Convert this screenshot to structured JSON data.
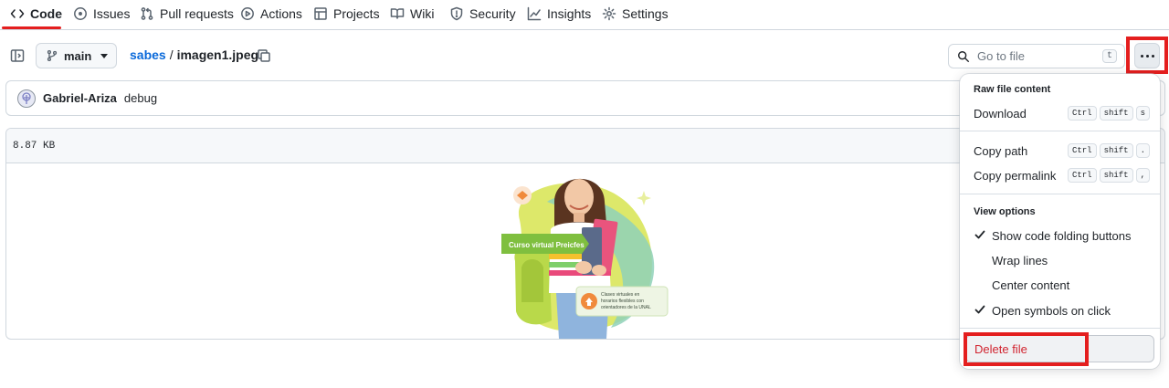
{
  "nav": {
    "tabs": [
      {
        "label": "Code",
        "icon": "code-icon",
        "active": true
      },
      {
        "label": "Issues",
        "icon": "issue-opened-icon"
      },
      {
        "label": "Pull requests",
        "icon": "git-pull-request-icon"
      },
      {
        "label": "Actions",
        "icon": "play-icon"
      },
      {
        "label": "Projects",
        "icon": "table-icon"
      },
      {
        "label": "Wiki",
        "icon": "book-icon"
      },
      {
        "label": "Security",
        "icon": "shield-icon"
      },
      {
        "label": "Insights",
        "icon": "graph-icon"
      },
      {
        "label": "Settings",
        "icon": "gear-icon"
      }
    ]
  },
  "file_header": {
    "branch": "main",
    "repo_link": "sabes",
    "separator": "/",
    "file_name": "imagen1.jpeg",
    "goto_placeholder": "Go to file",
    "goto_shortcut": "t"
  },
  "commit": {
    "author": "Gabriel-Ariza",
    "message": "debug"
  },
  "file": {
    "size": "8.87 KB",
    "preview_texts": {
      "badge": "Curso virtual Preicfes",
      "info_line1": "Clases virtuales en",
      "info_line2": "horarios flexibles con",
      "info_line3": "orientadores de la UNAL"
    }
  },
  "menu": {
    "section_raw": "Raw file content",
    "download": {
      "label": "Download",
      "keys": [
        "Ctrl",
        "shift",
        "s"
      ]
    },
    "copy_path": {
      "label": "Copy path",
      "keys": [
        "Ctrl",
        "shift",
        "."
      ]
    },
    "copy_permalink": {
      "label": "Copy permalink",
      "keys": [
        "Ctrl",
        "shift",
        ","
      ]
    },
    "section_view": "View options",
    "view_options": [
      {
        "label": "Show code folding buttons",
        "checked": true
      },
      {
        "label": "Wrap lines",
        "checked": false
      },
      {
        "label": "Center content",
        "checked": false
      },
      {
        "label": "Open symbols on click",
        "checked": true
      }
    ],
    "delete": "Delete file"
  },
  "colors": {
    "accent_link": "#0969da",
    "danger": "#d1242f",
    "highlight_box": "#e41e1e"
  }
}
